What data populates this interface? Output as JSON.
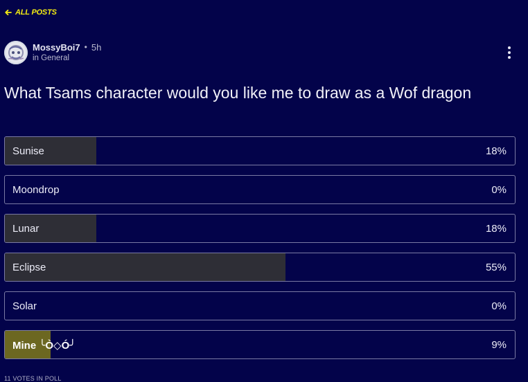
{
  "nav": {
    "back_label": "ALL POSTS"
  },
  "post": {
    "author": "MossyBoi7",
    "separator": "•",
    "time": "5h",
    "category": "in General",
    "title": "What Tsams character would you like me to draw as a Wof dragon"
  },
  "poll": {
    "options": [
      {
        "label": "Sunise",
        "percent_text": "18%",
        "percent": 18,
        "selected": false
      },
      {
        "label": "Moondrop",
        "percent_text": "0%",
        "percent": 0,
        "selected": false
      },
      {
        "label": "Lunar",
        "percent_text": "18%",
        "percent": 18,
        "selected": false
      },
      {
        "label": "Eclipse",
        "percent_text": "55%",
        "percent": 55,
        "selected": false
      },
      {
        "label": "Solar",
        "percent_text": "0%",
        "percent": 0,
        "selected": false
      },
      {
        "label": "Mine ╰Ò◇Ó╯",
        "percent_text": "9%",
        "percent": 9,
        "selected": true
      }
    ],
    "votes_label": "11 VOTES IN POLL"
  },
  "colors": {
    "background": "#03034a",
    "accent": "#f4ec12",
    "fill": "#2e2e36",
    "selected_fill": "#6c6721",
    "border": "#7a7aa4"
  },
  "icons": {
    "back": "arrow-left-icon",
    "more": "more-vertical-icon",
    "avatar": "avatar-image"
  }
}
